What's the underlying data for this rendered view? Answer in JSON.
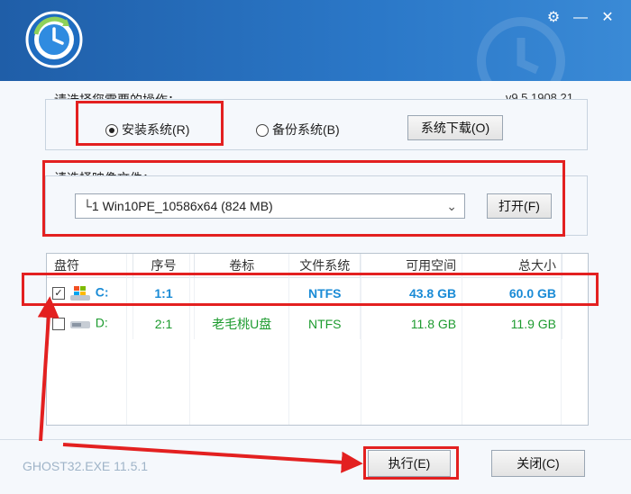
{
  "window": {
    "minimize_glyph": "⚙",
    "restore_glyph": "—",
    "close_glyph": "✕"
  },
  "version": "v9.5.1908.21",
  "operation": {
    "title": "请选择您需要的操作：",
    "install_label": "安装系统(R)",
    "backup_label": "备份系统(B)",
    "download_label": "系统下载(O)",
    "selected": "install"
  },
  "image": {
    "title": "请选择映像文件：",
    "selected_file": "└1 Win10PE_10586x64 (824 MB)",
    "open_label": "打开(F)"
  },
  "table": {
    "headers": [
      "盘符",
      "序号",
      "卷标",
      "文件系统",
      "可用空间",
      "总大小"
    ],
    "rows": [
      {
        "checked": true,
        "drive": "C:",
        "index": "1:1",
        "label": "",
        "fs": "NTFS",
        "free": "43.8 GB",
        "total": "60.0 GB"
      },
      {
        "checked": false,
        "drive": "D:",
        "index": "2:1",
        "label": "老毛桃U盘",
        "fs": "NTFS",
        "free": "11.8 GB",
        "total": "11.9 GB"
      }
    ]
  },
  "footer": {
    "app_version": "GHOST32.EXE 11.5.1",
    "execute_label": "执行(E)",
    "close_label": "关闭(C)"
  },
  "colors": {
    "titlebar": "#2b78c8",
    "annotation_red": "#e32020",
    "drive_green": "#1d9b2f",
    "selected_blue": "#1a8bd6"
  }
}
